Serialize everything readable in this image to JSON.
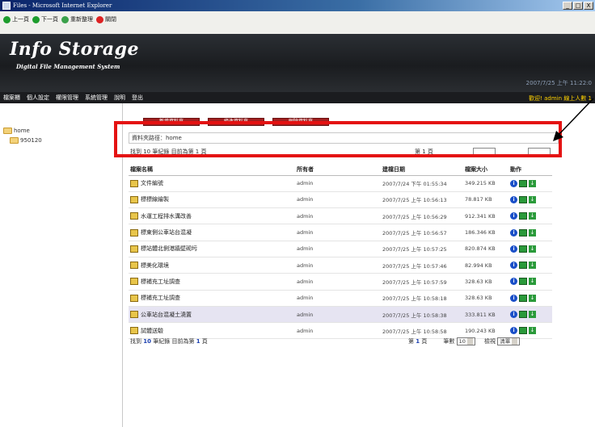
{
  "window": {
    "title": "Files - Microsoft Internet Explorer",
    "controls": [
      "_",
      "□",
      "X"
    ]
  },
  "toolbar": {
    "back": "上一頁",
    "forward": "下一頁",
    "refresh": "重新整理",
    "close": "關閉"
  },
  "banner": {
    "title": "Info Storage",
    "subtitle": "Digital File Management System",
    "datetime": "2007/7/25 上午 11:22:0"
  },
  "nav": {
    "items": [
      "檔案櫃",
      "個人設定",
      "權限管理",
      "系統管理",
      "說明",
      "登出"
    ],
    "welcome_prefix": "歡迎!",
    "user": "admin",
    "online": "線上人數 1"
  },
  "tree": {
    "root": "home",
    "child": "950120"
  },
  "content": {
    "buttons": [
      "新增資料夾",
      "修改資料夾",
      "刪除資料夾"
    ],
    "path_label": "資料夾路徑：home",
    "pager_top_left": "找到 10 筆紀錄 目前為第 1 頁",
    "pager_top_right": "第 1 頁",
    "columns": [
      "檔案名稱",
      "所有者",
      "建檔日期",
      "檔案大小",
      "動作"
    ],
    "rows": [
      {
        "name": "文件編號",
        "owner": "admin",
        "date": "2007/7/24 下午 01:55:34",
        "size": "349.215 KB",
        "highlight": false
      },
      {
        "name": "標標線繪製",
        "owner": "admin",
        "date": "2007/7/25 上午 10:56:13",
        "size": "78.817 KB",
        "highlight": false
      },
      {
        "name": "水運工程排水溝改善",
        "owner": "admin",
        "date": "2007/7/25 上午 10:56:29",
        "size": "912.341 KB",
        "highlight": false
      },
      {
        "name": "標東側公車站台混凝",
        "owner": "admin",
        "date": "2007/7/25 上午 10:56:57",
        "size": "186.346 KB",
        "highlight": false
      },
      {
        "name": "標站體北側港牆壁砌圬",
        "owner": "admin",
        "date": "2007/7/25 上午 10:57:25",
        "size": "820.874 KB",
        "highlight": false
      },
      {
        "name": "標美化環境",
        "owner": "admin",
        "date": "2007/7/25 上午 10:57:46",
        "size": "82.994 KB",
        "highlight": false
      },
      {
        "name": "標補充工址調查",
        "owner": "admin",
        "date": "2007/7/25 上午 10:57:59",
        "size": "328.63 KB",
        "highlight": false
      },
      {
        "name": "標補充工址調查",
        "owner": "admin",
        "date": "2007/7/25 上午 10:58:18",
        "size": "328.63 KB",
        "highlight": false
      },
      {
        "name": "公車站台混凝土澆置",
        "owner": "admin",
        "date": "2007/7/25 上午 10:58:38",
        "size": "333.811 KB",
        "highlight": true
      },
      {
        "name": "試體送驗",
        "owner": "admin",
        "date": "2007/7/25 上午 10:58:58",
        "size": "190.243 KB",
        "highlight": false
      }
    ],
    "pager_bottom": {
      "found_prefix": "找到",
      "count": "10",
      "count_suffix": "筆紀錄 目前為第",
      "page": "1",
      "page_suffix": "頁",
      "right_prefix": "第",
      "right_page": "1",
      "right_suffix": "頁",
      "size_label": "筆數",
      "size_value": "10",
      "view_label": "檢視",
      "view_value": "清單"
    }
  },
  "colors": {
    "annotation": "#e41212",
    "banner": "#1a1c1f",
    "highlight_row": "#e6e4f2",
    "welcome": "#ffd200"
  }
}
